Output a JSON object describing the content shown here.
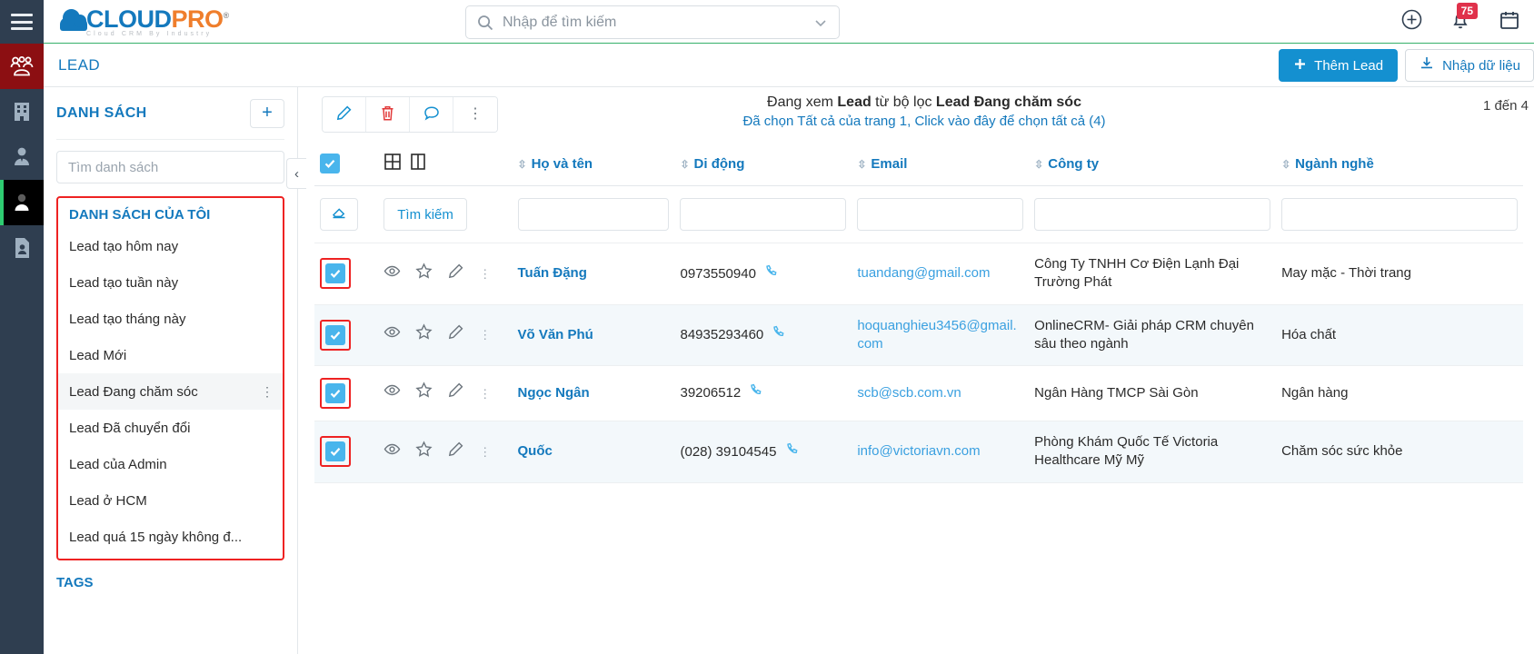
{
  "rail": {
    "menu_icon": "hamburger-menu-icon",
    "items": [
      {
        "icon": "people-group-icon",
        "name": "lead"
      },
      {
        "icon": "building-icon",
        "name": "company"
      },
      {
        "icon": "user-tie-icon",
        "name": "contact"
      },
      {
        "icon": "person-icon",
        "name": "account"
      },
      {
        "icon": "file-user-icon",
        "name": "document"
      }
    ]
  },
  "brand": {
    "name_blue": "CLOUD",
    "name_orange": "PRO",
    "registered": "®",
    "tagline": "Cloud CRM By Industry"
  },
  "search": {
    "placeholder": "Nhập để tìm kiếm",
    "value": "",
    "icon": "search-icon",
    "caret": "chevron-down-icon"
  },
  "top_icons": {
    "add": "plus-circle-icon",
    "notifications": "bell-icon",
    "notifications_badge": "75",
    "calendar": "calendar-icon"
  },
  "page": {
    "title": "LEAD",
    "add_button": "Thêm Lead",
    "add_button_icon": "plus-icon",
    "import_button": "Nhập dữ liệu",
    "import_button_icon": "download-icon"
  },
  "list_panel": {
    "title": "DANH SÁCH",
    "add_icon": "plus-icon",
    "search_placeholder": "Tìm danh sách",
    "search_value": "",
    "group_title": "DANH SÁCH CỦA TÔI",
    "items": [
      {
        "label": "Lead tạo hôm nay",
        "active": false
      },
      {
        "label": "Lead tạo tuần này",
        "active": false
      },
      {
        "label": "Lead tạo tháng này",
        "active": false
      },
      {
        "label": "Lead Mới",
        "active": false
      },
      {
        "label": "Lead Đang chăm sóc",
        "active": true
      },
      {
        "label": "Lead Đã chuyển đổi",
        "active": false
      },
      {
        "label": "Lead của Admin",
        "active": false
      },
      {
        "label": "Lead ở HCM",
        "active": false
      },
      {
        "label": "Lead quá 15 ngày không đ...",
        "active": false
      }
    ],
    "tags_title": "TAGS",
    "collapse_icon": "chevron-left-icon"
  },
  "toolbar": {
    "edit_icon": "pencil-icon",
    "delete_icon": "trash-icon",
    "comment_icon": "comment-icon",
    "more_icon": "kebab-menu-icon"
  },
  "filter_info": {
    "line1_prefix": "Đang xem ",
    "line1_entity": "Lead",
    "line1_mid": " từ bộ lọc ",
    "line1_filter": "Lead Đang chăm sóc",
    "line2": "Đã chọn Tất cả của trang 1, Click vào đây để chọn tất cả (4)",
    "pager": "1 đến 4"
  },
  "table": {
    "view_icons": [
      "grid-view-icon",
      "column-view-icon"
    ],
    "select_all_checked": true,
    "filter_row": {
      "clear_icon": "eraser-icon",
      "search_label": "Tìm kiếm",
      "values": [
        "",
        "",
        "",
        "",
        ""
      ]
    },
    "columns": [
      {
        "label": "Họ và tên",
        "sortable": true
      },
      {
        "label": "Di động",
        "sortable": true
      },
      {
        "label": "Email",
        "sortable": true
      },
      {
        "label": "Công ty",
        "sortable": true
      },
      {
        "label": "Ngành nghề",
        "sortable": true
      }
    ],
    "row_action_icons": [
      "eye-icon",
      "star-icon",
      "pencil-icon",
      "kebab-menu-icon"
    ],
    "rows": [
      {
        "checked": true,
        "name": "Tuấn Đặng",
        "mobile": "0973550940",
        "email": "tuandang@gmail.com",
        "company": "Công Ty TNHH Cơ Điện Lạnh Đại Trường Phát",
        "industry": "May mặc - Thời trang"
      },
      {
        "checked": true,
        "name": "Võ Văn Phú",
        "mobile": "84935293460",
        "email": "hoquanghieu3456@gmail.com",
        "company": "OnlineCRM- Giải pháp CRM chuyên sâu theo ngành",
        "industry": "Hóa chất"
      },
      {
        "checked": true,
        "name": "Ngọc Ngân",
        "mobile": "39206512",
        "email": "scb@scb.com.vn",
        "company": "Ngân Hàng TMCP Sài Gòn",
        "industry": "Ngân hàng"
      },
      {
        "checked": true,
        "name": "Quốc",
        "mobile": "(028) 39104545",
        "email": "info@victoriavn.com",
        "company": "Phòng Khám Quốc Tế Victoria Healthcare Mỹ Mỹ",
        "industry": "Chăm sóc sức khỏe"
      }
    ]
  },
  "colors": {
    "brand_blue": "#1479bd",
    "brand_orange": "#ef7e2c",
    "accent": "#1490d0",
    "highlight_red": "#ee2222",
    "badge_red": "#e0314b",
    "rail_dark": "#2f3e50",
    "rail_lead": "#8c0f12"
  }
}
